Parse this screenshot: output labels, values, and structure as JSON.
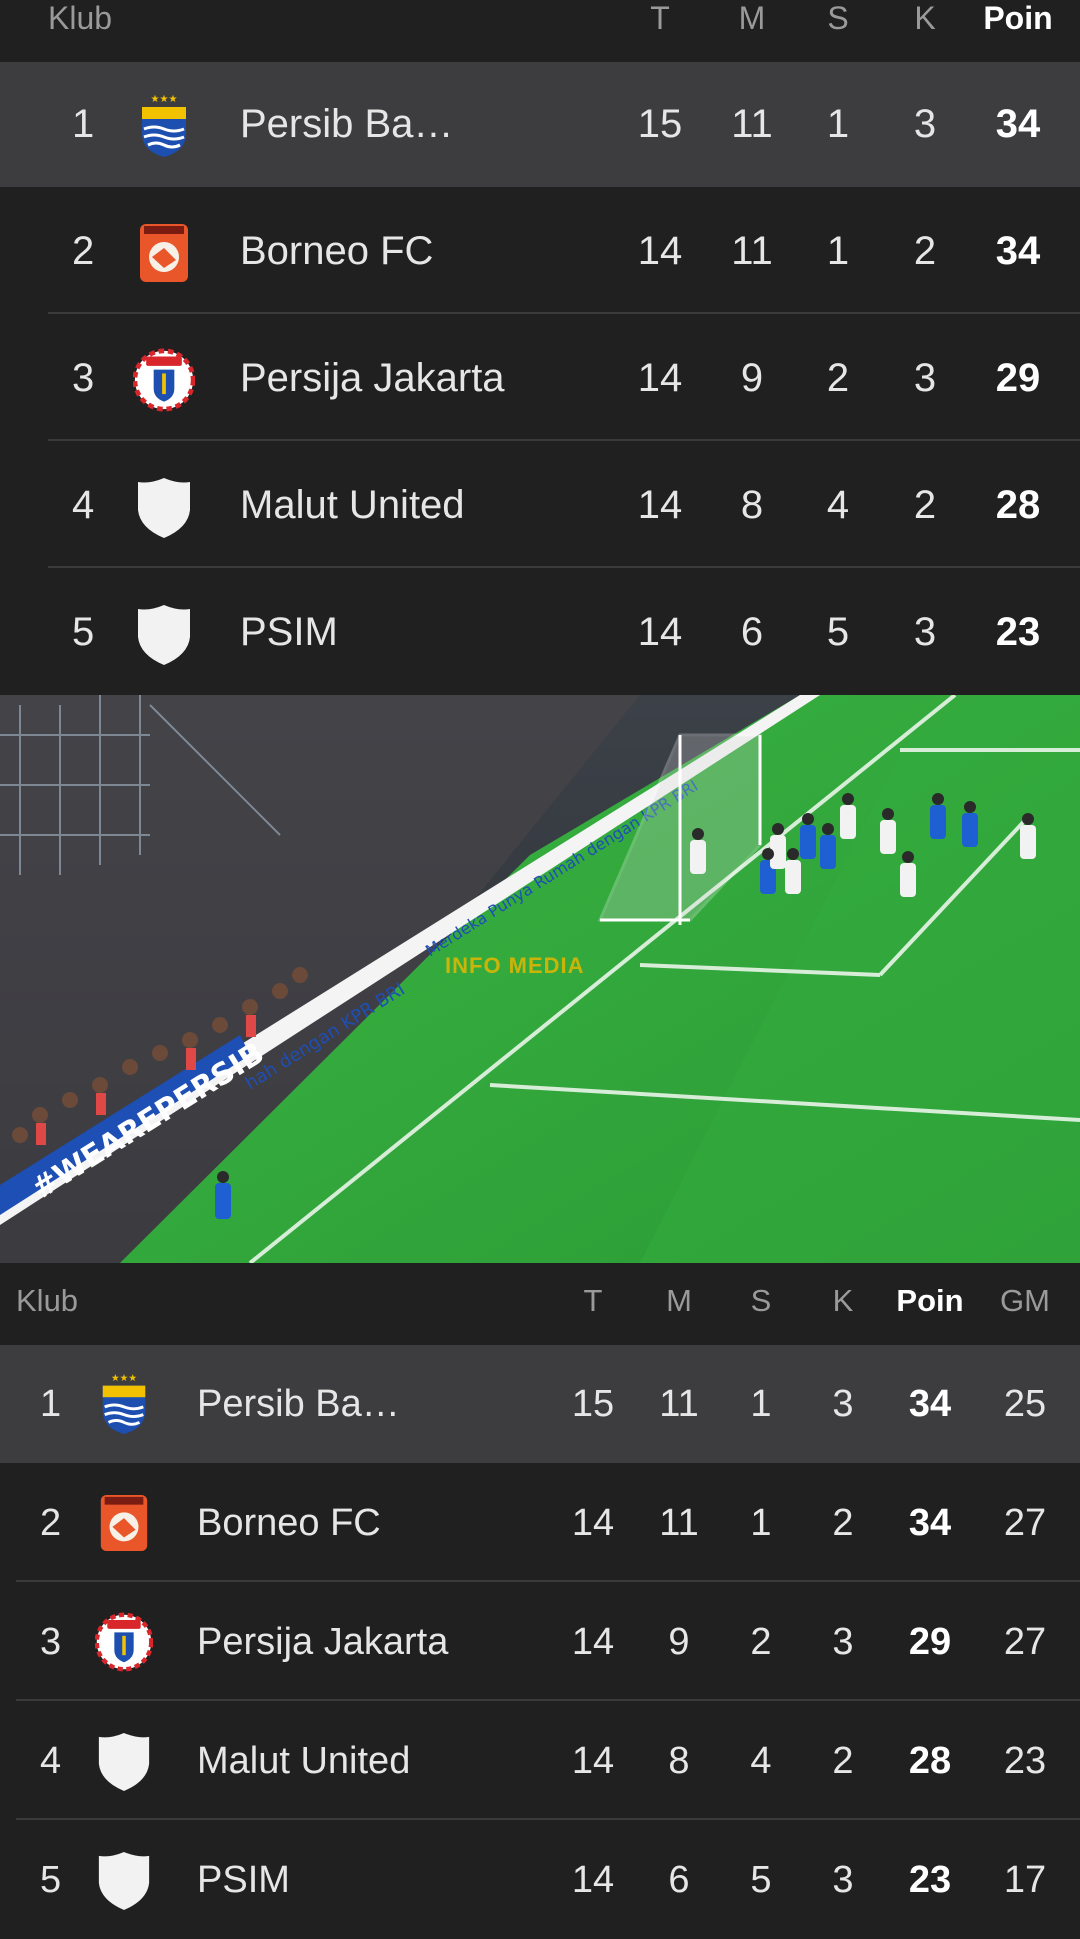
{
  "colors": {
    "background": "#202021",
    "highlight_row": "#3d3d3f",
    "header_text": "#9a9a9a",
    "text": "#e6e6e6",
    "pitch": "#2fa43a",
    "watermark": "#e5b700"
  },
  "table_top": {
    "headers": {
      "club": "Klub",
      "t": "T",
      "m": "M",
      "s": "S",
      "k": "K",
      "poin": "Poin"
    },
    "rows": [
      {
        "rank": "1",
        "name": "Persib Ba…",
        "crest": "persib-crest-icon",
        "t": "15",
        "m": "11",
        "s": "1",
        "k": "3",
        "poin": "34"
      },
      {
        "rank": "2",
        "name": "Borneo FC",
        "crest": "borneo-crest-icon",
        "t": "14",
        "m": "11",
        "s": "1",
        "k": "2",
        "poin": "34"
      },
      {
        "rank": "3",
        "name": "Persija Jakarta",
        "crest": "persija-crest-icon",
        "t": "14",
        "m": "9",
        "s": "2",
        "k": "3",
        "poin": "29"
      },
      {
        "rank": "4",
        "name": "Malut United",
        "crest": "placeholder-shield-icon",
        "t": "14",
        "m": "8",
        "s": "4",
        "k": "2",
        "poin": "28"
      },
      {
        "rank": "5",
        "name": "PSIM",
        "crest": "placeholder-shield-icon",
        "t": "14",
        "m": "6",
        "s": "5",
        "k": "3",
        "poin": "23"
      }
    ]
  },
  "video": {
    "watermark": "INFO  MEDIA",
    "ad_board_1": "Merdeka Punya Rumah dengan KPR BRI",
    "ad_board_2": "hah dengan KPR BRI",
    "hashtag_board": "#WEAREPERSIB"
  },
  "table_bottom": {
    "headers": {
      "club": "Klub",
      "t": "T",
      "m": "M",
      "s": "S",
      "k": "K",
      "poin": "Poin",
      "gm": "GM"
    },
    "rows": [
      {
        "rank": "1",
        "name": "Persib Ba…",
        "crest": "persib-crest-icon",
        "t": "15",
        "m": "11",
        "s": "1",
        "k": "3",
        "poin": "34",
        "gm": "25"
      },
      {
        "rank": "2",
        "name": "Borneo FC",
        "crest": "borneo-crest-icon",
        "t": "14",
        "m": "11",
        "s": "1",
        "k": "2",
        "poin": "34",
        "gm": "27"
      },
      {
        "rank": "3",
        "name": "Persija Jakarta",
        "crest": "persija-crest-icon",
        "t": "14",
        "m": "9",
        "s": "2",
        "k": "3",
        "poin": "29",
        "gm": "27"
      },
      {
        "rank": "4",
        "name": "Malut United",
        "crest": "placeholder-shield-icon",
        "t": "14",
        "m": "8",
        "s": "4",
        "k": "2",
        "poin": "28",
        "gm": "23"
      },
      {
        "rank": "5",
        "name": "PSIM",
        "crest": "placeholder-shield-icon",
        "t": "14",
        "m": "6",
        "s": "5",
        "k": "3",
        "poin": "23",
        "gm": "17"
      }
    ]
  }
}
